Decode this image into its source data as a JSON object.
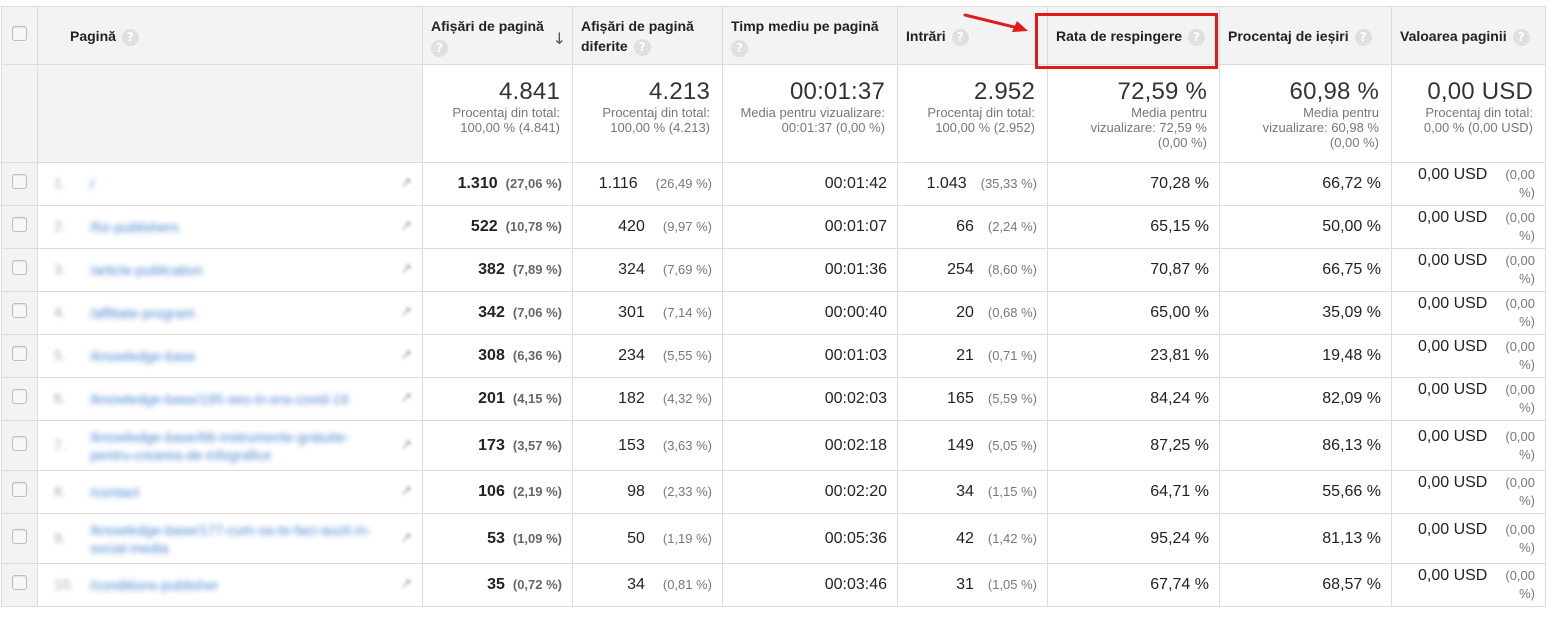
{
  "columns": {
    "page": "Pagină",
    "pageviews": "Afișări de pagină",
    "unique_pageviews": "Afișări de pagină diferite",
    "avg_time": "Timp mediu pe pagină",
    "entrances": "Intrări",
    "bounce_rate": "Rata de respingere",
    "exit_pct": "Procentaj de ieșiri",
    "page_value": "Valoarea paginii"
  },
  "help_glyph": "?",
  "sort_glyph": "↓",
  "totals": {
    "pageviews": {
      "value": "4.841",
      "note": "Procentaj din total: 100,00 % (4.841)"
    },
    "unique_pageviews": {
      "value": "4.213",
      "note": "Procentaj din total: 100,00 % (4.213)"
    },
    "avg_time": {
      "value": "00:01:37",
      "note": "Media pentru vizualizare: 00:01:37 (0,00 %)"
    },
    "entrances": {
      "value": "2.952",
      "note": "Procentaj din total: 100,00 % (2.952)"
    },
    "bounce_rate": {
      "value": "72,59 %",
      "note": "Media pentru vizualizare: 72,59 % (0,00 %)"
    },
    "exit_pct": {
      "value": "60,98 %",
      "note": "Media pentru vizualizare: 60,98 % (0,00 %)"
    },
    "page_value": {
      "value": "0,00 USD",
      "note": "Procentaj din total: 0,00 % (0,00 USD)"
    }
  },
  "rows": [
    {
      "index": "1.",
      "page": "/",
      "pageviews": "1.310",
      "pageviews_pct": "(27,06 %)",
      "unique": "1.116",
      "unique_pct": "(26,49 %)",
      "avg_time": "00:01:42",
      "entrances": "1.043",
      "entrances_pct": "(35,33 %)",
      "bounce": "70,28 %",
      "exit": "66,72 %",
      "value": "0,00 USD",
      "value_pct": "(0,00 %)"
    },
    {
      "index": "2.",
      "page": "/for-publishers",
      "pageviews": "522",
      "pageviews_pct": "(10,78 %)",
      "unique": "420",
      "unique_pct": "(9,97 %)",
      "avg_time": "00:01:07",
      "entrances": "66",
      "entrances_pct": "(2,24 %)",
      "bounce": "65,15 %",
      "exit": "50,00 %",
      "value": "0,00 USD",
      "value_pct": "(0,00 %)"
    },
    {
      "index": "3.",
      "page": "/article-publication",
      "pageviews": "382",
      "pageviews_pct": "(7,89 %)",
      "unique": "324",
      "unique_pct": "(7,69 %)",
      "avg_time": "00:01:36",
      "entrances": "254",
      "entrances_pct": "(8,60 %)",
      "bounce": "70,87 %",
      "exit": "66,75 %",
      "value": "0,00 USD",
      "value_pct": "(0,00 %)"
    },
    {
      "index": "4.",
      "page": "/affiliate-program",
      "pageviews": "342",
      "pageviews_pct": "(7,06 %)",
      "unique": "301",
      "unique_pct": "(7,14 %)",
      "avg_time": "00:00:40",
      "entrances": "20",
      "entrances_pct": "(0,68 %)",
      "bounce": "65,00 %",
      "exit": "35,09 %",
      "value": "0,00 USD",
      "value_pct": "(0,00 %)"
    },
    {
      "index": "5.",
      "page": "/knowledge-base",
      "pageviews": "308",
      "pageviews_pct": "(6,36 %)",
      "unique": "234",
      "unique_pct": "(5,55 %)",
      "avg_time": "00:01:03",
      "entrances": "21",
      "entrances_pct": "(0,71 %)",
      "bounce": "23,81 %",
      "exit": "19,48 %",
      "value": "0,00 USD",
      "value_pct": "(0,00 %)"
    },
    {
      "index": "6.",
      "page": "/knowledge-base/195-seo-in-era-covid-19",
      "pageviews": "201",
      "pageviews_pct": "(4,15 %)",
      "unique": "182",
      "unique_pct": "(4,32 %)",
      "avg_time": "00:02:03",
      "entrances": "165",
      "entrances_pct": "(5,59 %)",
      "bounce": "84,24 %",
      "exit": "82,09 %",
      "value": "0,00 USD",
      "value_pct": "(0,00 %)"
    },
    {
      "index": "7.",
      "page": "/knowledge-base/66-instrumente-gratuite-pentru-crearea-de-infografice",
      "pageviews": "173",
      "pageviews_pct": "(3,57 %)",
      "unique": "153",
      "unique_pct": "(3,63 %)",
      "avg_time": "00:02:18",
      "entrances": "149",
      "entrances_pct": "(5,05 %)",
      "bounce": "87,25 %",
      "exit": "86,13 %",
      "value": "0,00 USD",
      "value_pct": "(0,00 %)"
    },
    {
      "index": "8.",
      "page": "/contact",
      "pageviews": "106",
      "pageviews_pct": "(2,19 %)",
      "unique": "98",
      "unique_pct": "(2,33 %)",
      "avg_time": "00:02:20",
      "entrances": "34",
      "entrances_pct": "(1,15 %)",
      "bounce": "64,71 %",
      "exit": "55,66 %",
      "value": "0,00 USD",
      "value_pct": "(0,00 %)"
    },
    {
      "index": "9.",
      "page": "/knowledge-base/177-cum-sa-te-faci-auzit-in-social-media",
      "pageviews": "53",
      "pageviews_pct": "(1,09 %)",
      "unique": "50",
      "unique_pct": "(1,19 %)",
      "avg_time": "00:05:36",
      "entrances": "42",
      "entrances_pct": "(1,42 %)",
      "bounce": "95,24 %",
      "exit": "81,13 %",
      "value": "0,00 USD",
      "value_pct": "(0,00 %)"
    },
    {
      "index": "10.",
      "page": "/conditions-publisher",
      "pageviews": "35",
      "pageviews_pct": "(0,72 %)",
      "unique": "34",
      "unique_pct": "(0,81 %)",
      "avg_time": "00:03:46",
      "entrances": "31",
      "entrances_pct": "(1,05 %)",
      "bounce": "67,74 %",
      "exit": "68,57 %",
      "value": "0,00 USD",
      "value_pct": "(0,00 %)"
    }
  ],
  "highlight_color": "#e01b1b",
  "link_color": "#1a66c5"
}
